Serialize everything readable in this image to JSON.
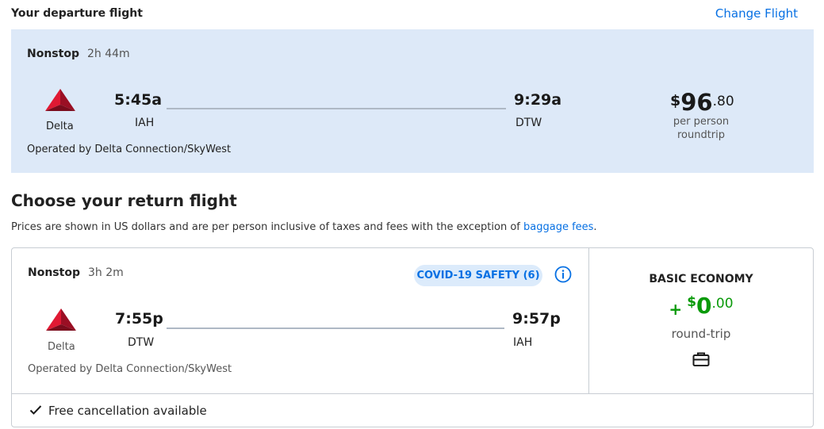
{
  "departure": {
    "section_title": "Your departure flight",
    "change_link": "Change Flight",
    "stops": "Nonstop",
    "duration": "2h 44m",
    "airline": "Delta",
    "depart_time": "5:45a",
    "depart_airport": "IAH",
    "arrive_time": "9:29a",
    "arrive_airport": "DTW",
    "operated_by": "Operated by Delta Connection/SkyWest",
    "price": {
      "currency": "$",
      "whole": "96",
      "cents": ".80",
      "per_person": "per person",
      "trip_type": "roundtrip"
    }
  },
  "return_section": {
    "title": "Choose your return flight",
    "note_prefix": "Prices are shown in US dollars and are per person inclusive of taxes and fees with the exception of ",
    "note_link": "baggage fees",
    "note_suffix": "."
  },
  "return_flight": {
    "stops": "Nonstop",
    "duration": "3h 2m",
    "covid_badge": "COVID-19 SAFETY (6)",
    "airline": "Delta",
    "depart_time": "7:55p",
    "depart_airport": "DTW",
    "arrive_time": "9:57p",
    "arrive_airport": "IAH",
    "operated_by": "Operated by Delta Connection/SkyWest",
    "fare": {
      "class": "BASIC ECONOMY",
      "plus": "+",
      "currency": "$",
      "whole": "0",
      "cents": ".00",
      "trip_type": "round-trip"
    },
    "cancellation": "Free cancellation available"
  },
  "colors": {
    "accent": "#0770e3",
    "price_green": "#0a9a0a",
    "card_bg": "#dde9f8",
    "delta_red": "#c01933"
  },
  "icons": [
    "delta-logo-icon",
    "info-icon",
    "baggage-icon",
    "check-icon"
  ]
}
